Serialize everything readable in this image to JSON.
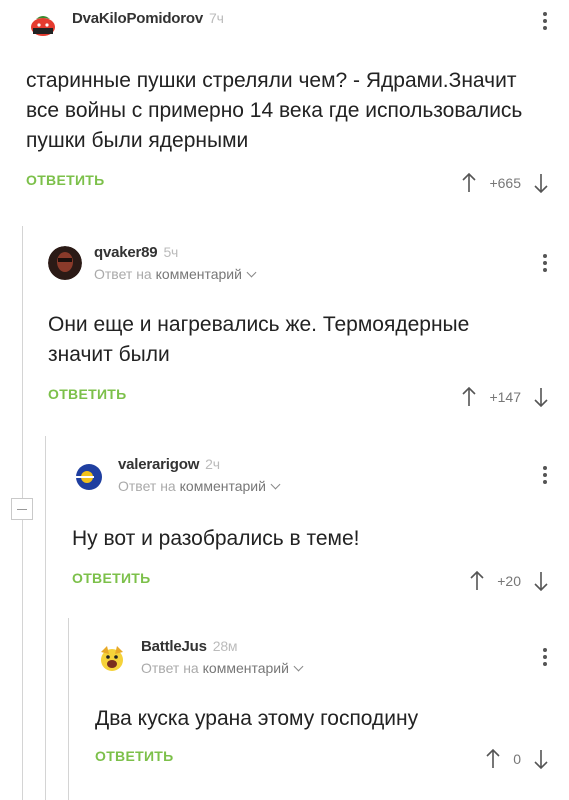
{
  "comments": [
    {
      "author": "DvaKiloPomidorov",
      "time": "7ч",
      "text": "старинные пушки стреляли чем? - Ядрами.Значит все войны с примерно 14 века где использовались пушки были ядерными",
      "reply_label": "ОТВЕТИТЬ",
      "votes": "+665"
    },
    {
      "author": "qvaker89",
      "time": "5ч",
      "reply_prefix": "Ответ на",
      "reply_target": "комментарий",
      "text": "Они еще и нагревались же. Термоядерные значит были",
      "reply_label": "ОТВЕТИТЬ",
      "votes": "+147"
    },
    {
      "author": "valerarigow",
      "time": "2ч",
      "reply_prefix": "Ответ на",
      "reply_target": "комментарий",
      "text": "Ну вот и разобрались в теме!",
      "reply_label": "ОТВЕТИТЬ",
      "votes": "+20"
    },
    {
      "author": "BattleJus",
      "time": "28м",
      "reply_prefix": "Ответ на",
      "reply_target": "комментарий",
      "text": "Два куска урана этому господину",
      "reply_label": "ОТВЕТИТЬ",
      "votes": "0"
    }
  ],
  "colors": {
    "accent_green": "#7cc04a",
    "thread_line": "#d4d4d4"
  }
}
